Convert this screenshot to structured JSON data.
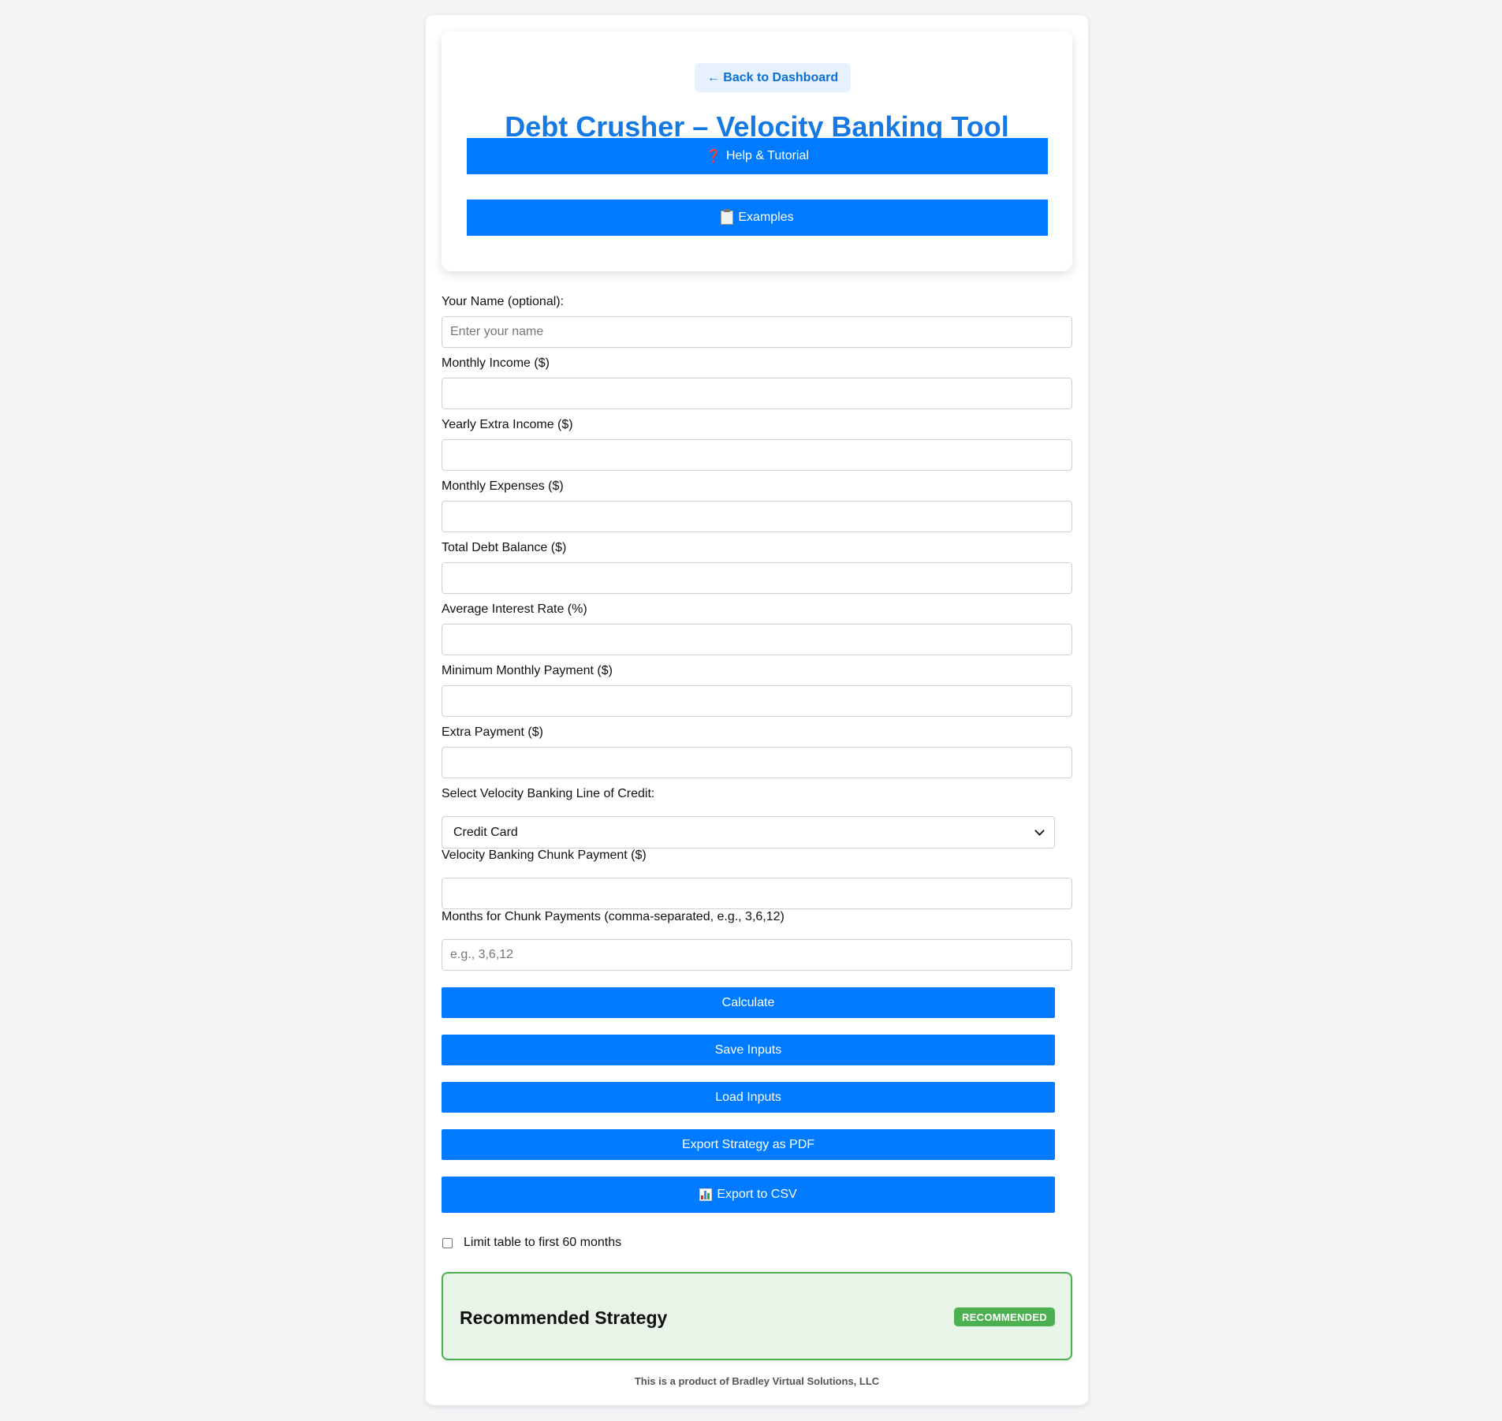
{
  "header": {
    "back_label": "← Back to Dashboard",
    "title": "Debt Crusher – Velocity Banking Tool",
    "help_label": "Help & Tutorial",
    "examples_label": "Examples"
  },
  "form": {
    "name_label": "Your Name (optional):",
    "name_placeholder": "Enter your name",
    "monthly_income_label": "Monthly Income ($)",
    "yearly_extra_label": "Yearly Extra Income ($)",
    "monthly_expenses_label": "Monthly Expenses ($)",
    "total_debt_label": "Total Debt Balance ($)",
    "interest_rate_label": "Average Interest Rate (%)",
    "min_payment_label": "Minimum Monthly Payment ($)",
    "extra_payment_label": "Extra Payment ($)",
    "loc_label": "Select Velocity Banking Line of Credit:",
    "loc_selected": "Credit Card",
    "chunk_payment_label": "Velocity Banking Chunk Payment ($)",
    "chunk_months_label": "Months for Chunk Payments (comma-separated, e.g., 3,6,12)",
    "chunk_months_placeholder": "e.g., 3,6,12"
  },
  "actions": {
    "calculate": "Calculate",
    "save": "Save Inputs",
    "load": "Load Inputs",
    "export_pdf": "Export Strategy as PDF",
    "export_csv": "Export to CSV",
    "limit_label": "Limit table to first 60 months",
    "limit_checked": false
  },
  "recommendation": {
    "title": "Recommended Strategy",
    "badge": "RECOMMENDED"
  },
  "footer": {
    "text": "This is a product of Bradley Virtual Solutions, LLC"
  },
  "icons": {
    "help": "question-mark-icon",
    "examples": "clipboard-icon",
    "csv": "bar-chart-icon"
  },
  "colors": {
    "primary": "#007bff",
    "title": "#1479e4",
    "success": "#4caf50",
    "success_bg": "#e8f4e8",
    "background": "#f4f4f7"
  }
}
